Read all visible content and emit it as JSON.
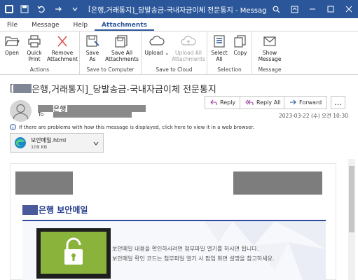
{
  "titlebar": {
    "title_prefix": "[",
    "title_suffix": "은행,거래통지]_당발송금-국내자금이체 전문통지  -  Message (HTML)",
    "icons": [
      "outlook-icon",
      "save-icon",
      "undo-icon",
      "arrow-icon",
      "search-icon",
      "minimize-icon",
      "maximize-icon",
      "close-icon"
    ]
  },
  "tabs": [
    "File",
    "Message",
    "Help",
    "Attachments"
  ],
  "ribbon": {
    "groups": [
      {
        "label": "Actions",
        "buttons": [
          {
            "label": "Open",
            "icon": "open-folder-icon"
          },
          {
            "label": "Quick Print",
            "icon": "print-icon"
          },
          {
            "label": "Remove Attachment",
            "icon": "remove-icon"
          }
        ]
      },
      {
        "label": "Save to Computer",
        "buttons": [
          {
            "label": "Save As",
            "icon": "save-as-icon"
          },
          {
            "label": "Save All Attachments",
            "icon": "save-all-icon"
          }
        ]
      },
      {
        "label": "Save to Cloud",
        "buttons": [
          {
            "label": "Upload",
            "icon": "cloud-upload-icon"
          },
          {
            "label": "Upload All Attachments",
            "icon": "cloud-upload-all-icon",
            "disabled": true
          }
        ]
      },
      {
        "label": "Selection",
        "buttons": [
          {
            "label": "Select All",
            "icon": "select-all-icon"
          },
          {
            "label": "Copy",
            "icon": "copy-icon"
          }
        ]
      },
      {
        "label": "Message",
        "buttons": [
          {
            "label": "Show Message",
            "icon": "show-message-icon"
          }
        ]
      }
    ]
  },
  "message": {
    "subject_prefix": "[",
    "subject_suffix": "은행,거래통지]_당발송금-국내자금이체 전문통지",
    "sender_name": "은행",
    "to_label": "To",
    "timestamp": "2023-03-22 (수) 오전 10:30",
    "actions": {
      "reply": "Reply",
      "reply_all": "Reply All",
      "forward": "Forward",
      "more": "..."
    },
    "info_text": "If there are problems with how this message is displayed, click here to view it in a web browser.",
    "attachment": {
      "name": "보안메일.html",
      "size": "109 KB"
    }
  },
  "body": {
    "bank_title": "은행 보안메일",
    "line1": "보안메일 내용을 확인하시려면 첨부파일 열기를 하시면 됩니다.",
    "line2": "보안메일 확인 코드는 첨부파일 열기 시 팝업 화면 설명을 참고하세요."
  },
  "colors": {
    "titlebar": "#2b579a",
    "accent": "#2b579a",
    "bank_blue": "#243c8c",
    "monitor_screen": "#8ab33c"
  }
}
